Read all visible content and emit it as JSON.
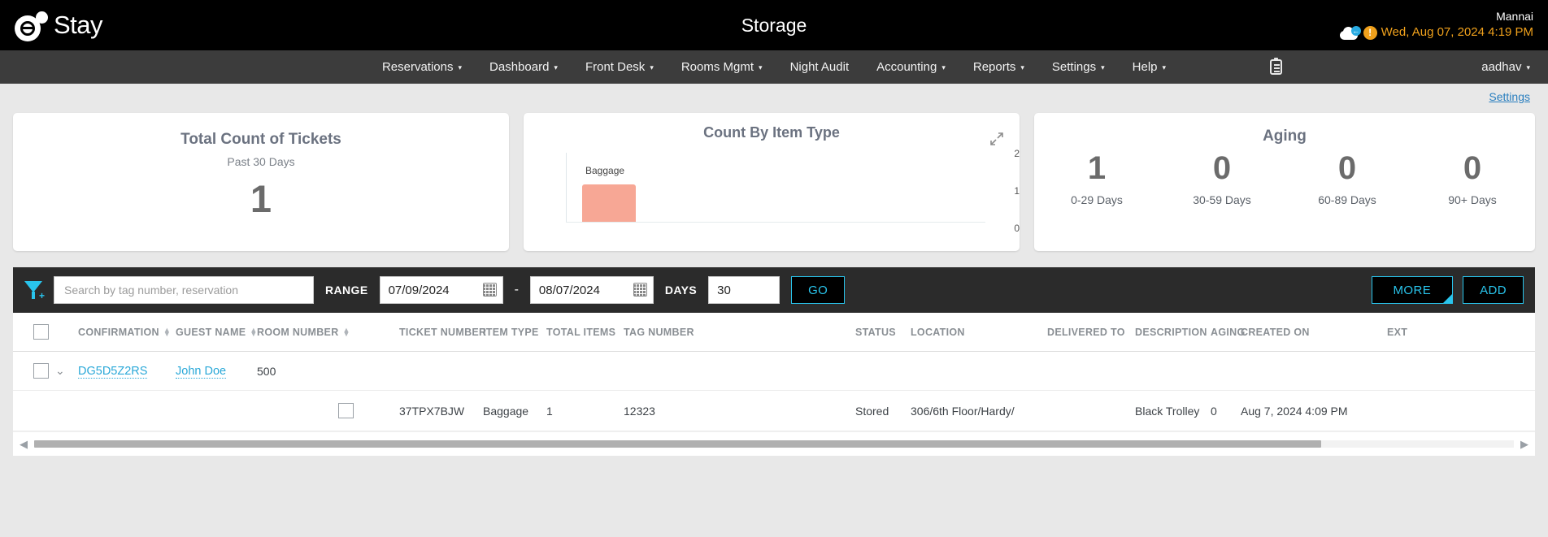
{
  "topbar": {
    "logo_text": "Stay",
    "app_title": "Storage",
    "tenant": "Mannai",
    "datetime": "Wed, Aug 07, 2024 4:19 PM",
    "cloud_icon": "cloud-sync-icon",
    "alert_icon": "alert-icon",
    "alert_glyph": "!"
  },
  "nav": {
    "items": [
      {
        "label": "Reservations",
        "caret": "▾"
      },
      {
        "label": "Dashboard",
        "caret": "▾"
      },
      {
        "label": "Front Desk",
        "caret": "▾"
      },
      {
        "label": "Rooms Mgmt",
        "caret": "▾"
      },
      {
        "label": "Night Audit",
        "caret": ""
      },
      {
        "label": "Accounting",
        "caret": "▾"
      },
      {
        "label": "Reports",
        "caret": "▾"
      },
      {
        "label": "Settings",
        "caret": "▾"
      },
      {
        "label": "Help",
        "caret": "▾"
      }
    ],
    "clipboard_icon": "clipboard-icon",
    "user": "aadhav",
    "user_caret": "▾"
  },
  "settings_link": "Settings",
  "cards": {
    "tickets": {
      "title": "Total Count of Tickets",
      "subtitle": "Past 30 Days",
      "value": "1"
    },
    "chart": {
      "title": "Count By Item Type",
      "expand_icon": "expand-icon"
    },
    "aging": {
      "title": "Aging",
      "buckets": [
        {
          "value": "1",
          "label": "0-29 Days"
        },
        {
          "value": "0",
          "label": "30-59 Days"
        },
        {
          "value": "0",
          "label": "60-89 Days"
        },
        {
          "value": "0",
          "label": "90+ Days"
        }
      ]
    }
  },
  "chart_data": {
    "type": "bar",
    "title": "Count By Item Type",
    "categories": [
      "Baggage"
    ],
    "values": [
      1
    ],
    "data_labels": [
      "Baggage"
    ],
    "bar_color": "#f7a795",
    "xlabel": "",
    "ylabel": "",
    "ylim": [
      0,
      2
    ],
    "yticks": [
      0,
      1,
      2
    ],
    "ytick_labels": [
      "0",
      "1",
      "2"
    ],
    "grid": false,
    "legend": false
  },
  "toolbar": {
    "filter_icon": "filter-add-icon",
    "search_placeholder": "Search by tag number, reservation",
    "search_value": "",
    "range_label": "RANGE",
    "date_from": "07/09/2024",
    "date_to": "08/07/2024",
    "range_separator": "-",
    "days_label": "DAYS",
    "days_value": "30",
    "go_label": "GO",
    "more_label": "MORE",
    "add_label": "ADD",
    "calendar_icon": "calendar-icon"
  },
  "table": {
    "headers": [
      {
        "label": "CONFIRMATION",
        "sortable": true
      },
      {
        "label": "GUEST NAME",
        "sortable": true
      },
      {
        "label": "ROOM NUMBER",
        "sortable": true
      },
      {
        "label": "TICKET NUMBER",
        "sortable": false
      },
      {
        "label": "ITEM TYPE",
        "sortable": false
      },
      {
        "label": "TOTAL ITEMS",
        "sortable": false
      },
      {
        "label": "TAG NUMBER",
        "sortable": false
      },
      {
        "label": "STATUS",
        "sortable": false
      },
      {
        "label": "LOCATION",
        "sortable": false
      },
      {
        "label": "DELIVERED TO",
        "sortable": false
      },
      {
        "label": "DESCRIPTION",
        "sortable": false
      },
      {
        "label": "AGING",
        "sortable": false
      },
      {
        "label": "CREATED ON",
        "sortable": false
      },
      {
        "label": "EXT",
        "sortable": false
      }
    ],
    "sort_glyph_up": "▲",
    "sort_glyph_down": "▼",
    "expander_glyph": "⌄",
    "group_row": {
      "confirmation": "DG5D5Z2RS",
      "guest_name": "John Doe",
      "room_number": "500"
    },
    "detail_row": {
      "ticket_number": "37TPX7BJW",
      "item_type": "Baggage",
      "total_items": "1",
      "tag_number": "12323",
      "status": "Stored",
      "location": "306/6th Floor/Hardy/",
      "delivered_to": "",
      "description": "Black Trolley",
      "aging": "0",
      "created_on": "Aug 7, 2024 4:09 PM",
      "ext": ""
    }
  },
  "scrollbar": {
    "left_arrow": "◀",
    "right_arrow": "▶"
  }
}
